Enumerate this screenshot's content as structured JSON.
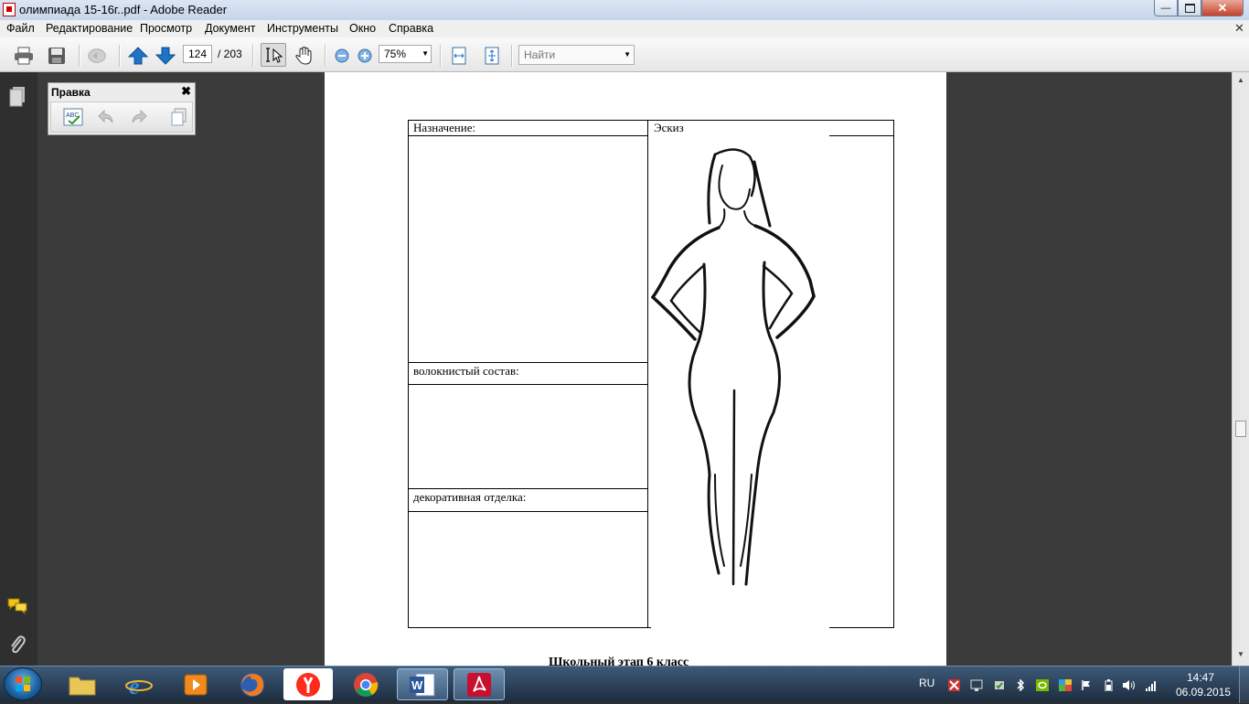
{
  "window": {
    "title": "олимпиада 15-16г..pdf - Adobe Reader",
    "min_icon": "minimize-icon",
    "max_icon": "maximize-icon",
    "close_icon": "close-icon",
    "close_glyph": "✕"
  },
  "menu": {
    "items": [
      "Файл",
      "Редактирование",
      "Просмотр",
      "Документ",
      "Инструменты",
      "Окно",
      "Справка"
    ],
    "doc_close_glyph": "✕"
  },
  "toolbar": {
    "page_current": "124",
    "page_total": "/ 203",
    "zoom": "75%",
    "find_placeholder": "Найти"
  },
  "panel": {
    "title": "Правка",
    "close_glyph": "✖"
  },
  "document": {
    "table": {
      "purpose_label": "Назначение:",
      "sketch_label": "Эскиз",
      "fiber_label": "волокнистый состав:",
      "decor_label": "декоративная отделка:"
    },
    "next_heading": "Школьный этап 6 класс"
  },
  "taskbar": {
    "language": "RU",
    "time": "14:47",
    "date": "06.09.2015"
  },
  "colors": {
    "workspace": "#3b3b3b",
    "toolbar_arrow": "#1e73c8",
    "reader_red": "#c8102e"
  }
}
